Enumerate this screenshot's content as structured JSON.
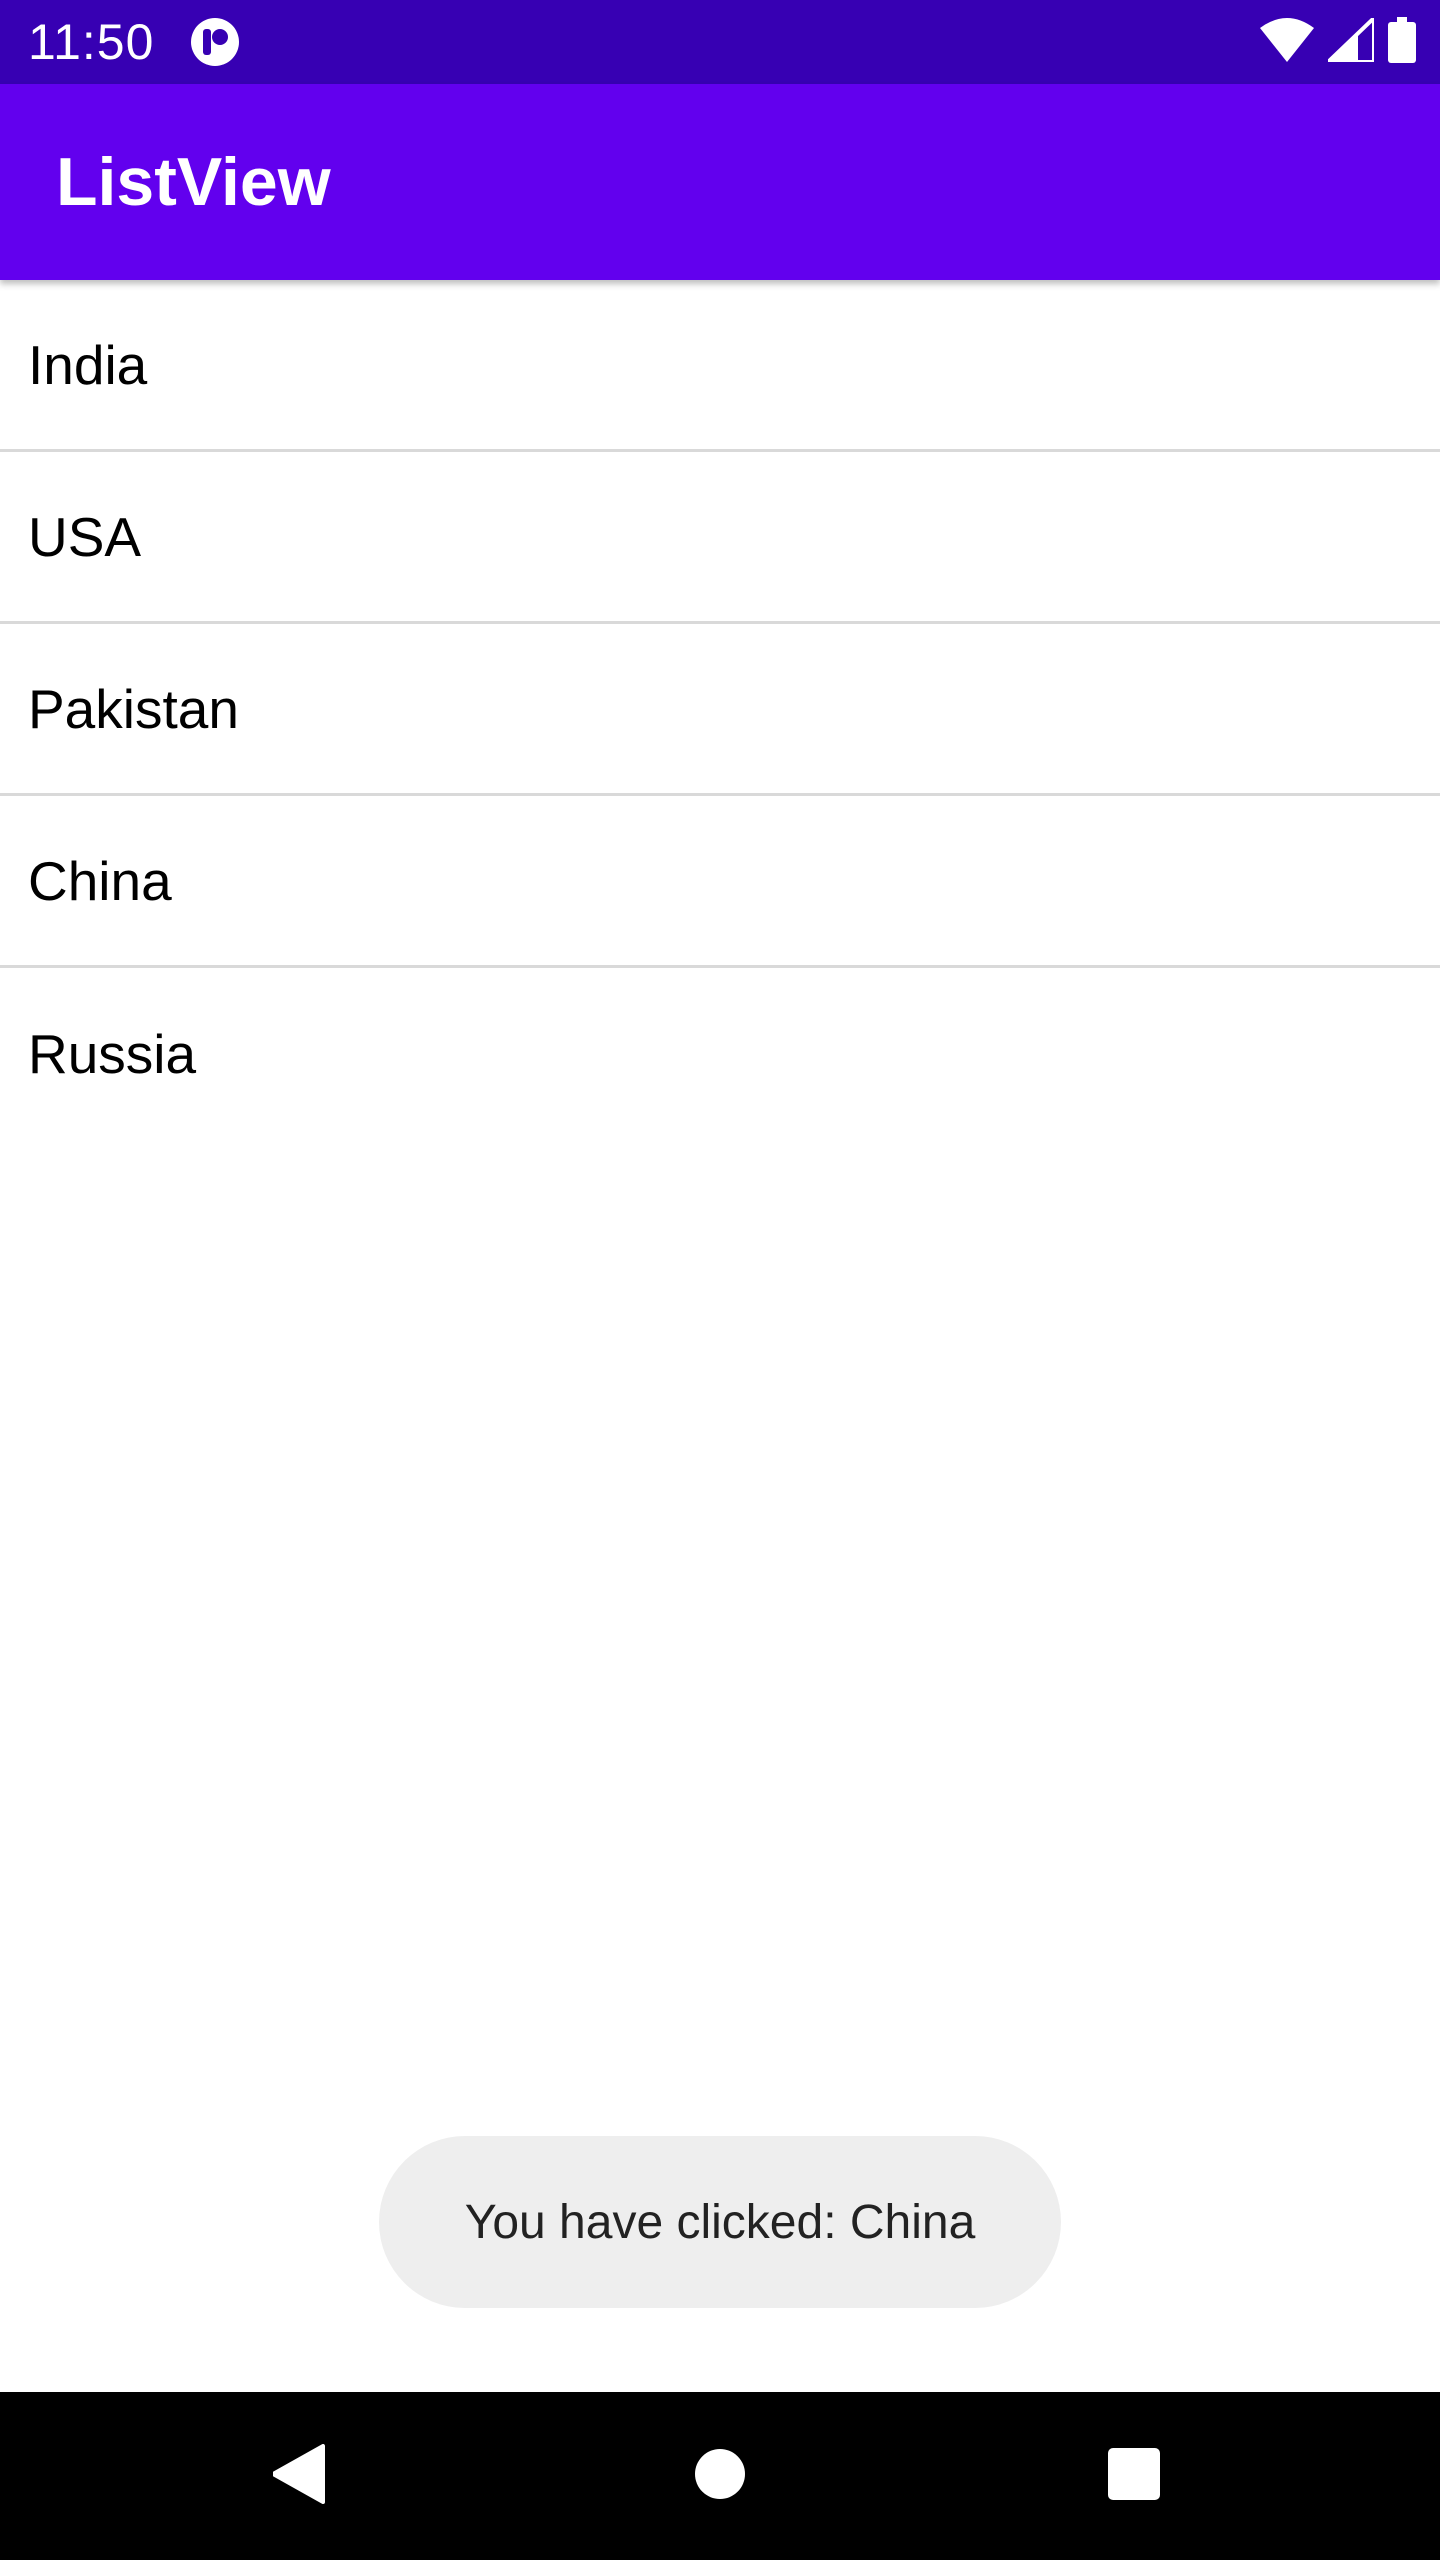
{
  "status_bar": {
    "time": "11:50",
    "app_icon": "app-notification-icon",
    "wifi_icon": "wifi-icon",
    "signal_icon": "cell-signal-icon",
    "battery_icon": "battery-icon"
  },
  "app_bar": {
    "title": "ListView"
  },
  "list": {
    "items": [
      {
        "label": "India"
      },
      {
        "label": "USA"
      },
      {
        "label": "Pakistan"
      },
      {
        "label": "China"
      },
      {
        "label": "Russia"
      }
    ]
  },
  "toast": {
    "message": "You have clicked: China"
  },
  "nav_bar": {
    "back_icon": "back-icon",
    "home_icon": "home-icon",
    "recents_icon": "recents-icon"
  },
  "colors": {
    "status_bar": "#3700b3",
    "app_bar": "#6200ee",
    "divider": "#d9d9d9",
    "toast_bg": "#eeeeee",
    "nav_bar": "#000000"
  }
}
